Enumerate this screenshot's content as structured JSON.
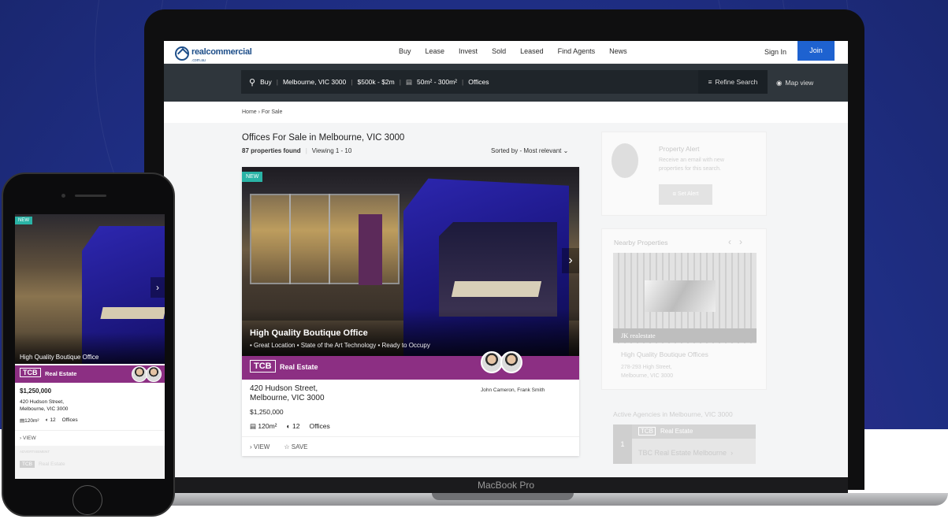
{
  "colors": {
    "brand": "#1d4e89",
    "join": "#1e62d0",
    "agency": "#8c2f83",
    "new_badge": "#2ab3a6"
  },
  "laptop": {
    "label": "MacBook Pro",
    "nav": {
      "logo": "realcommercial",
      "logo_sub": ".com.au",
      "links": [
        "Buy",
        "Lease",
        "Invest",
        "Sold",
        "Leased",
        "Find Agents",
        "News"
      ],
      "sign_in": "Sign In",
      "join": "Join"
    },
    "search": {
      "icon": "search-icon",
      "mode": "Buy",
      "location": "Melbourne, VIC 3000",
      "price": "$500k - $2m",
      "size": "50m² - 300m²",
      "type": "Offices",
      "refine": "Refine Search",
      "map_view": "Map view"
    },
    "breadcrumb": [
      "Home",
      "For Sale"
    ],
    "results": {
      "title": "Offices For Sale in Melbourne, VIC 3000",
      "count": "87 properties found",
      "viewing": "Viewing 1 - 10",
      "sort": "Sorted by - Most relevant"
    },
    "listing": {
      "badge": "NEW",
      "title": "High Quality Boutique Office",
      "highlights": "• Great Location • State of the Art Technology • Ready to Occupy",
      "agency_logo": "TCB",
      "agency_name": "Real Estate",
      "agents": "John Cameron, Frank Smith",
      "address_line1": "420 Hudson Street,",
      "address_line2": "Melbourne, VIC 3000",
      "price": "$1,250,000",
      "area": "120m²",
      "parking": "12",
      "type": "Offices",
      "view": "VIEW",
      "save": "SAVE"
    },
    "alert": {
      "title": "Property Alert",
      "text": "Receive an email with new properties for this search.",
      "button": "Set Alert"
    },
    "nearby": {
      "title": "Nearby Properties",
      "agency": "JK realestate",
      "name": "High Quality Boutique Offices",
      "address_line1": "278-293 High Street,",
      "address_line2": "Melbourne, VIC 3000"
    },
    "active": {
      "title": "Active Agencies in Melbourne, VIC 3000",
      "rank": "1",
      "logo": "TCB",
      "agency": "Real Estate",
      "name": "TBC Real Estate Melbourne"
    }
  },
  "phone": {
    "badge": "NEW",
    "title": "High Quality Boutique Office",
    "agency_logo": "TCB",
    "agency_name": "Real Estate",
    "price": "$1,250,000",
    "address_line1": "420 Hudson Street,",
    "address_line2": "Melbourne, VIC 3000",
    "area": "120m²",
    "parking": "12",
    "type": "Offices",
    "view": "VIEW",
    "ad_label": "ADVERTISEMENT",
    "ad_logo": "TCB",
    "ad_name": "Real Estate"
  }
}
